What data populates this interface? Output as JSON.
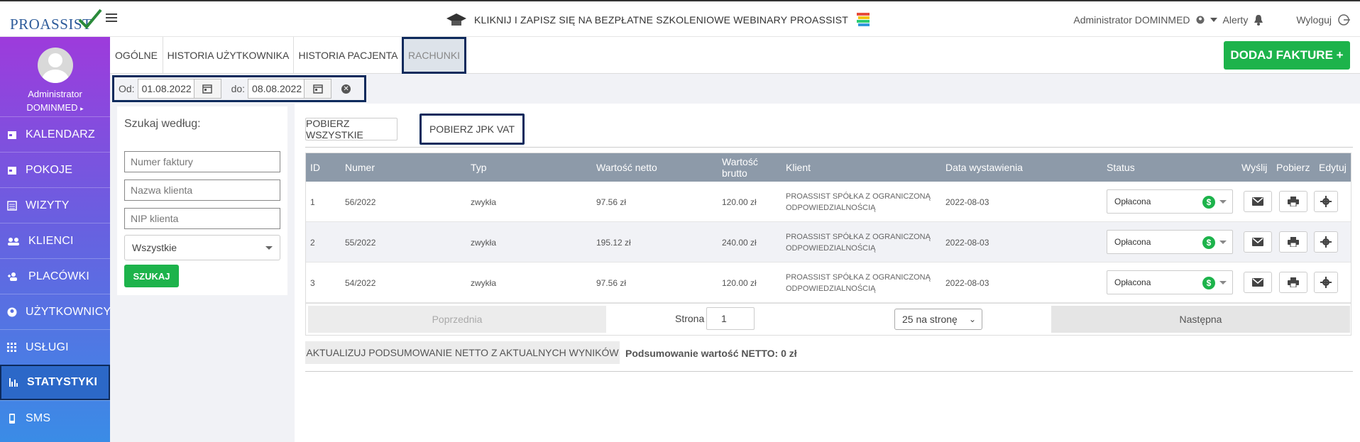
{
  "topbar": {
    "logo_text": "PROASSIST",
    "promo_text": "KLIKNIJ I ZAPISZ SIĘ NA BEZPŁATNE SZKOLENIOWE WEBINARY PROASSIST",
    "user_name": "Administrator DOMINMED",
    "alerts_label": "Alerty",
    "logout_label": "Wyloguj"
  },
  "sidebar": {
    "profile_name_line1": "Administrator",
    "profile_name_line2": "DOMINMED",
    "items": [
      {
        "label": "KALENDARZ",
        "icon": "calendar-icon"
      },
      {
        "label": "POKOJE",
        "icon": "calendar-icon"
      },
      {
        "label": "WIZYTY",
        "icon": "list-icon"
      },
      {
        "label": "KLIENCI",
        "icon": "users-icon"
      },
      {
        "label": "PLACÓWKI",
        "icon": "user-plus-icon"
      },
      {
        "label": "UŻYTKOWNICY",
        "icon": "user-circle-icon"
      },
      {
        "label": "USŁUGI",
        "icon": "grid-icon"
      },
      {
        "label": "STATYSTYKI",
        "icon": "bar-chart-icon",
        "active": true
      },
      {
        "label": "SMS",
        "icon": "phone-icon"
      }
    ]
  },
  "tabs": [
    {
      "label": "OGÓLNE"
    },
    {
      "label": "HISTORIA UŻYTKOWNIKA"
    },
    {
      "label": "HISTORIA PACJENTA"
    },
    {
      "label": "RACHUNKI",
      "active": true
    }
  ],
  "add_invoice_label": "DODAJ FAKTURE +",
  "filter": {
    "from_label": "Od:",
    "from_value": "01.08.2022",
    "to_label": "do:",
    "to_value": "08.08.2022"
  },
  "search": {
    "title": "Szukaj według:",
    "invoice_placeholder": "Numer faktury",
    "client_placeholder": "Nazwa klienta",
    "nip_placeholder": "NIP klienta",
    "select_value": "Wszystkie",
    "button_label": "SZUKAJ"
  },
  "downloads": {
    "all_label": "POBIERZ WSZYSTKIE",
    "jpk_label": "POBIERZ JPK VAT"
  },
  "table": {
    "headers": {
      "id": "ID",
      "numer": "Numer",
      "typ": "Typ",
      "netto": "Wartość netto",
      "brutto_line1": "Wartość",
      "brutto_line2": "brutto",
      "klient": "Klient",
      "data": "Data wystawienia",
      "status": "Status",
      "wyslij": "Wyślij",
      "pobierz": "Pobierz",
      "edytuj": "Edytuj"
    },
    "rows": [
      {
        "id": "1",
        "numer": "56/2022",
        "typ": "zwykła",
        "netto": "97.56 zł",
        "brutto": "120.00 zł",
        "klient_line1": "PROASSIST SPÓŁKA Z OGRANICZONĄ",
        "klient_line2": "ODPOWIEDZIALNOŚCIĄ",
        "data": "2022-08-03",
        "status": "Opłacona"
      },
      {
        "id": "2",
        "numer": "55/2022",
        "typ": "zwykła",
        "netto": "195.12 zł",
        "brutto": "240.00 zł",
        "klient_line1": "PROASSIST SPÓŁKA Z OGRANICZONĄ",
        "klient_line2": "ODPOWIEDZIALNOŚCIĄ",
        "data": "2022-08-03",
        "status": "Opłacona"
      },
      {
        "id": "3",
        "numer": "54/2022",
        "typ": "zwykła",
        "netto": "97.56 zł",
        "brutto": "120.00 zł",
        "klient_line1": "PROASSIST SPÓŁKA Z OGRANICZONĄ",
        "klient_line2": "ODPOWIEDZIALNOŚCIĄ",
        "data": "2022-08-03",
        "status": "Opłacona"
      }
    ]
  },
  "pagination": {
    "prev_label": "Poprzednia",
    "page_label": "Strona",
    "page_value": "1",
    "per_page": "25 na stronę",
    "next_label": "Następna"
  },
  "summary": {
    "update_label": "AKTUALIZUJ PODSUMOWANIE NETTO Z AKTUALNYCH WYNIKÓW",
    "text": "Podsumowanie wartość NETTO: 0 zł"
  },
  "colors": {
    "green": "#1db34b",
    "highlight_border": "#0d2a5c",
    "table_header": "#8d9aa9"
  }
}
